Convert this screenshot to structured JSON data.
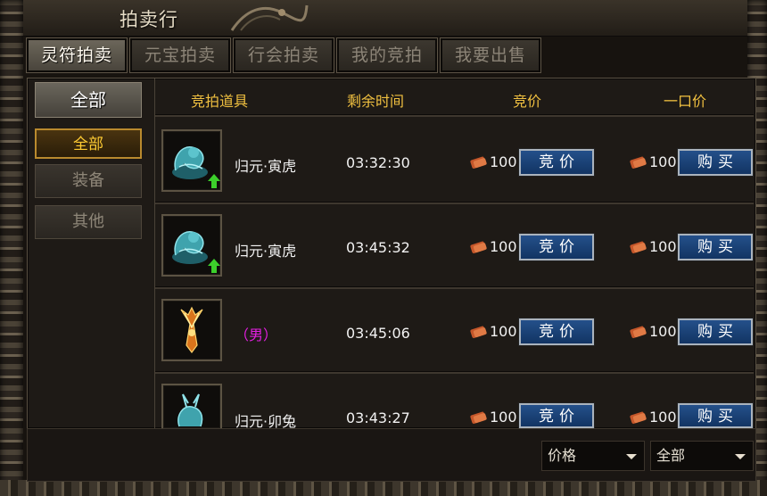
{
  "window": {
    "title": "拍卖行"
  },
  "tabs": [
    {
      "label": "灵符拍卖",
      "active": true
    },
    {
      "label": "元宝拍卖",
      "active": false
    },
    {
      "label": "行会拍卖",
      "active": false
    },
    {
      "label": "我的竞拍",
      "active": false
    },
    {
      "label": "我要出售",
      "active": false
    }
  ],
  "sidebar": {
    "header": "全部",
    "items": [
      {
        "label": "全部",
        "active": true
      },
      {
        "label": "装备",
        "active": false
      },
      {
        "label": "其他",
        "active": false
      }
    ]
  },
  "columns": {
    "item": "竞拍道具",
    "time": "剩余时间",
    "bid": "竞价",
    "buyout": "一口价"
  },
  "rows": [
    {
      "name": "归元·寅虎",
      "icon": "jade-tiger-icon",
      "upgrade": true,
      "time": "03:32:30",
      "bid_price": "100",
      "buyout_price": "100"
    },
    {
      "name": "归元·寅虎",
      "icon": "jade-tiger-icon",
      "upgrade": true,
      "time": "03:45:32",
      "bid_price": "100",
      "buyout_price": "100"
    },
    {
      "name": "（男）",
      "icon": "flame-armor-icon",
      "upgrade": false,
      "time": "03:45:06",
      "bid_price": "100",
      "buyout_price": "100",
      "name_color": "#e21fe0"
    },
    {
      "name": "归元·卯兔",
      "icon": "jade-rabbit-icon",
      "upgrade": false,
      "time": "03:43:27",
      "bid_price": "100",
      "buyout_price": "100"
    }
  ],
  "buttons": {
    "bid": "竞价",
    "buy": "购买"
  },
  "filters": {
    "sort": {
      "selected": "价格"
    },
    "category": {
      "selected": "全部"
    }
  },
  "colors": {
    "header_gold": "#f0c040",
    "button_blue": "#1f4b85",
    "pink_name": "#e21fe0"
  }
}
